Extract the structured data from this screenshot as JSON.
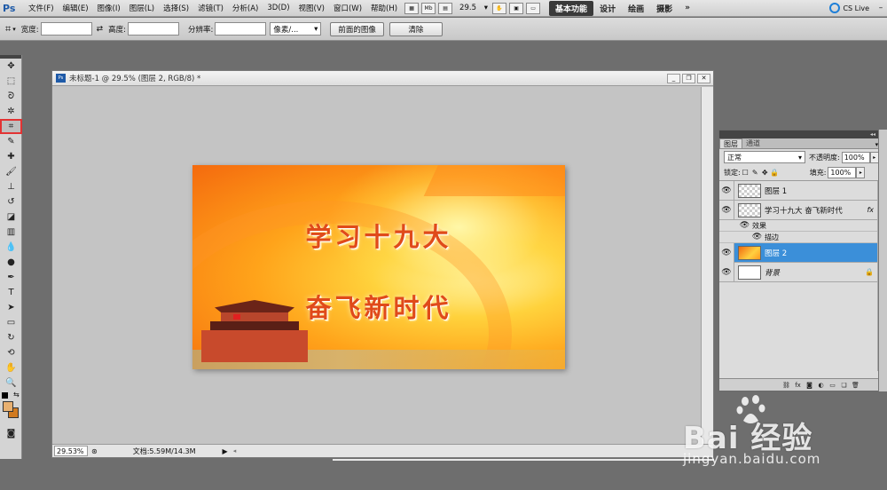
{
  "app": {
    "logo": "Ps"
  },
  "menu": [
    "文件(F)",
    "编辑(E)",
    "图像(I)",
    "图层(L)",
    "选择(S)",
    "滤镜(T)",
    "分析(A)",
    "3D(D)",
    "视图(V)",
    "窗口(W)",
    "帮助(H)"
  ],
  "appbar": {
    "mb_label": "Mb",
    "zoom": "29.5"
  },
  "workspaces": [
    "基本功能",
    "设计",
    "绘画",
    "摄影"
  ],
  "workspace_more": "»",
  "cs_live": "CS Live",
  "options": {
    "width_label": "宽度:",
    "height_label": "高度:",
    "resolution_label": "分辨率:",
    "unit": "像素/...",
    "front_image_btn": "前面的图像",
    "clear_btn": "清除"
  },
  "document": {
    "title": "未标题-1 @ 29.5% (图层 2, RGB/8) *",
    "zoom_pct": "29.53%",
    "doc_info": "文档:5.59M/14.3M",
    "canvas_text_1": "学习十九大",
    "canvas_text_2": "奋飞新时代"
  },
  "layers_panel": {
    "tabs": [
      "图层",
      "通道"
    ],
    "blend_mode": "正常",
    "opacity_label": "不透明度:",
    "opacity": "100%",
    "lock_label": "锁定:",
    "fill_label": "填充:",
    "fill": "100%",
    "layers": [
      {
        "name": "图层 1",
        "thumb": "checker",
        "selected": false
      },
      {
        "name": "学习十九大 奋飞新时代",
        "thumb": "checker",
        "fx": "fx",
        "selected": false
      },
      {
        "name": "图层 2",
        "thumb": "img",
        "selected": true
      },
      {
        "name": "背景",
        "thumb": "white",
        "lock": true,
        "selected": false
      }
    ],
    "effects_label": "效果",
    "stroke_label": "描边"
  },
  "watermark": {
    "text": "Bai 经验",
    "url": "jingyan.baidu.com"
  },
  "colors": {
    "accent": "#3b8fd9",
    "highlight": "#e23333"
  }
}
